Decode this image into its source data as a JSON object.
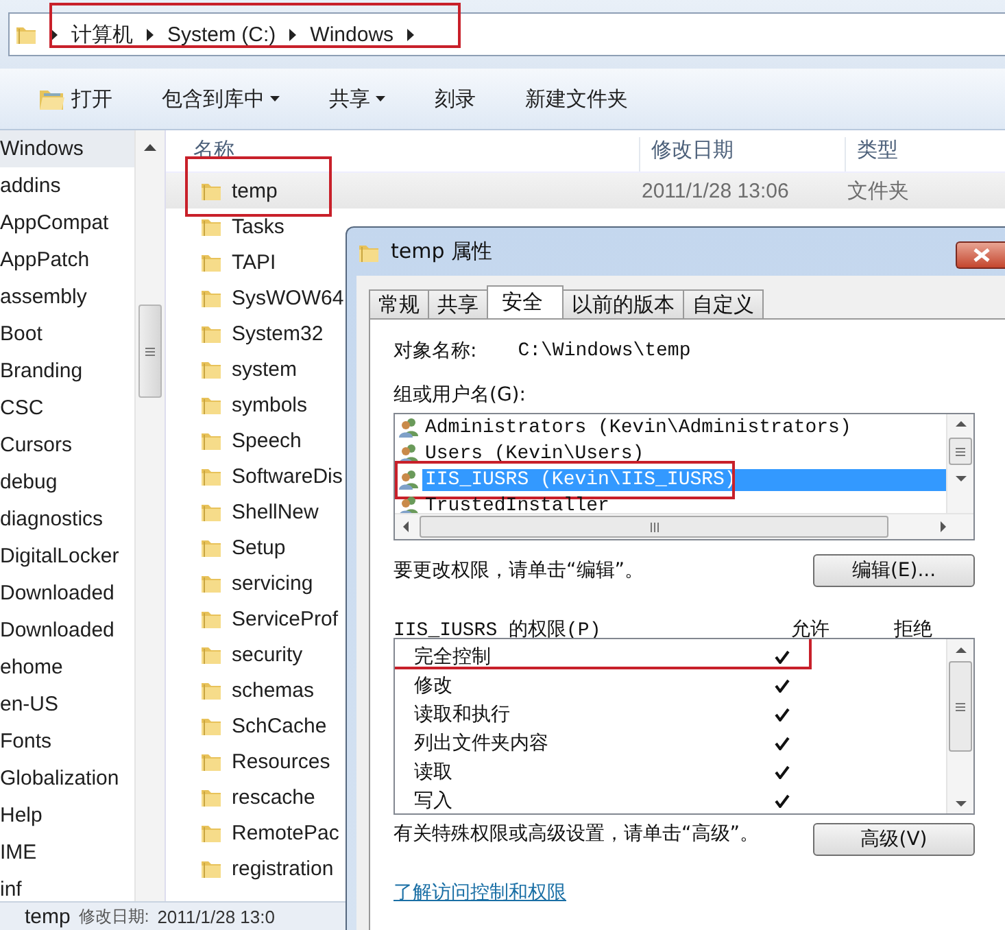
{
  "address_bar": {
    "highlighted": true,
    "crumbs": [
      "计算机",
      "System (C:)",
      "Windows"
    ]
  },
  "toolbar": [
    {
      "label": "打开",
      "kind": "icon"
    },
    {
      "label": "包含到库中",
      "kind": "menu"
    },
    {
      "label": "共享",
      "kind": "menu"
    },
    {
      "label": "刻录",
      "kind": "plain"
    },
    {
      "label": "新建文件夹",
      "kind": "plain"
    }
  ],
  "nav_pane": [
    {
      "label": "Windows",
      "selected": true
    },
    {
      "label": "addins",
      "selected": false
    },
    {
      "label": "AppCompat",
      "selected": false
    },
    {
      "label": "AppPatch",
      "selected": false
    },
    {
      "label": "assembly",
      "selected": false
    },
    {
      "label": "Boot",
      "selected": false
    },
    {
      "label": "Branding",
      "selected": false
    },
    {
      "label": "CSC",
      "selected": false
    },
    {
      "label": "Cursors",
      "selected": false
    },
    {
      "label": "debug",
      "selected": false
    },
    {
      "label": "diagnostics",
      "selected": false
    },
    {
      "label": "DigitalLocker",
      "selected": false
    },
    {
      "label": "Downloaded",
      "selected": false
    },
    {
      "label": "Downloaded",
      "selected": false
    },
    {
      "label": "ehome",
      "selected": false
    },
    {
      "label": "en-US",
      "selected": false
    },
    {
      "label": "Fonts",
      "selected": false
    },
    {
      "label": "Globalization",
      "selected": false
    },
    {
      "label": "Help",
      "selected": false
    },
    {
      "label": "IME",
      "selected": false
    },
    {
      "label": "inf",
      "selected": false
    }
  ],
  "file_list": {
    "columns": [
      "名称",
      "修改日期",
      "类型"
    ],
    "rows": [
      {
        "name": "temp",
        "date": "2011/1/28 13:06",
        "type": "文件夹",
        "selected": true,
        "highlighted": true
      },
      {
        "name": "Tasks",
        "selected": false,
        "highlighted": false
      },
      {
        "name": "TAPI",
        "selected": false,
        "highlighted": false
      },
      {
        "name": "SysWOW64",
        "selected": false,
        "highlighted": false
      },
      {
        "name": "System32",
        "selected": false,
        "highlighted": false
      },
      {
        "name": "system",
        "selected": false,
        "highlighted": false
      },
      {
        "name": "symbols",
        "selected": false,
        "highlighted": false
      },
      {
        "name": "Speech",
        "selected": false,
        "highlighted": false
      },
      {
        "name": "SoftwareDis",
        "selected": false,
        "highlighted": false
      },
      {
        "name": "ShellNew",
        "selected": false,
        "highlighted": false
      },
      {
        "name": "Setup",
        "selected": false,
        "highlighted": false
      },
      {
        "name": "servicing",
        "selected": false,
        "highlighted": false
      },
      {
        "name": "ServiceProf",
        "selected": false,
        "highlighted": false
      },
      {
        "name": "security",
        "selected": false,
        "highlighted": false
      },
      {
        "name": "schemas",
        "selected": false,
        "highlighted": false
      },
      {
        "name": "SchCache",
        "selected": false,
        "highlighted": false
      },
      {
        "name": "Resources",
        "selected": false,
        "highlighted": false
      },
      {
        "name": "rescache",
        "selected": false,
        "highlighted": false
      },
      {
        "name": "RemotePac",
        "selected": false,
        "highlighted": false
      },
      {
        "name": "registration",
        "selected": false,
        "highlighted": false
      }
    ]
  },
  "status_bar": {
    "name": "temp",
    "date_label": "修改日期:",
    "date": "2011/1/28 13:0"
  },
  "dialog": {
    "title": "temp 属性",
    "tabs": [
      {
        "label": "常规",
        "selected": false
      },
      {
        "label": "共享",
        "selected": false
      },
      {
        "label": "安全",
        "selected": true
      },
      {
        "label": "以前的版本",
        "selected": false
      },
      {
        "label": "自定义",
        "selected": false
      }
    ],
    "object_label": "对象名称:",
    "object_value": "C:\\Windows\\temp",
    "group_label": "组或用户名(G):",
    "users": [
      {
        "name": "Administrators (Kevin\\Administrators)",
        "selected": false,
        "highlighted": false
      },
      {
        "name": "Users (Kevin\\Users)",
        "selected": false,
        "highlighted": false
      },
      {
        "name": "IIS_IUSRS (Kevin\\IIS_IUSRS)",
        "selected": true,
        "highlighted": true
      },
      {
        "name": "TrustedInstaller",
        "selected": false,
        "highlighted": false
      }
    ],
    "edit_hint": "要更改权限，请单击“编辑”。",
    "edit_button": "编辑(E)...",
    "permissions_label": "IIS_IUSRS 的权限(P)",
    "allow_header": "允许",
    "deny_header": "拒绝",
    "permissions": [
      {
        "name": "完全控制",
        "allow": true,
        "deny": false,
        "highlighted": true
      },
      {
        "name": "修改",
        "allow": true,
        "deny": false,
        "highlighted": false
      },
      {
        "name": "读取和执行",
        "allow": true,
        "deny": false,
        "highlighted": false
      },
      {
        "name": "列出文件夹内容",
        "allow": true,
        "deny": false,
        "highlighted": false
      },
      {
        "name": "读取",
        "allow": true,
        "deny": false,
        "highlighted": false
      },
      {
        "name": "写入",
        "allow": true,
        "deny": false,
        "highlighted": false
      }
    ],
    "advanced_hint": "有关特殊权限或高级设置，请单击“高级”。",
    "advanced_button": "高级(V)",
    "help_link": "了解访问控制和权限"
  }
}
